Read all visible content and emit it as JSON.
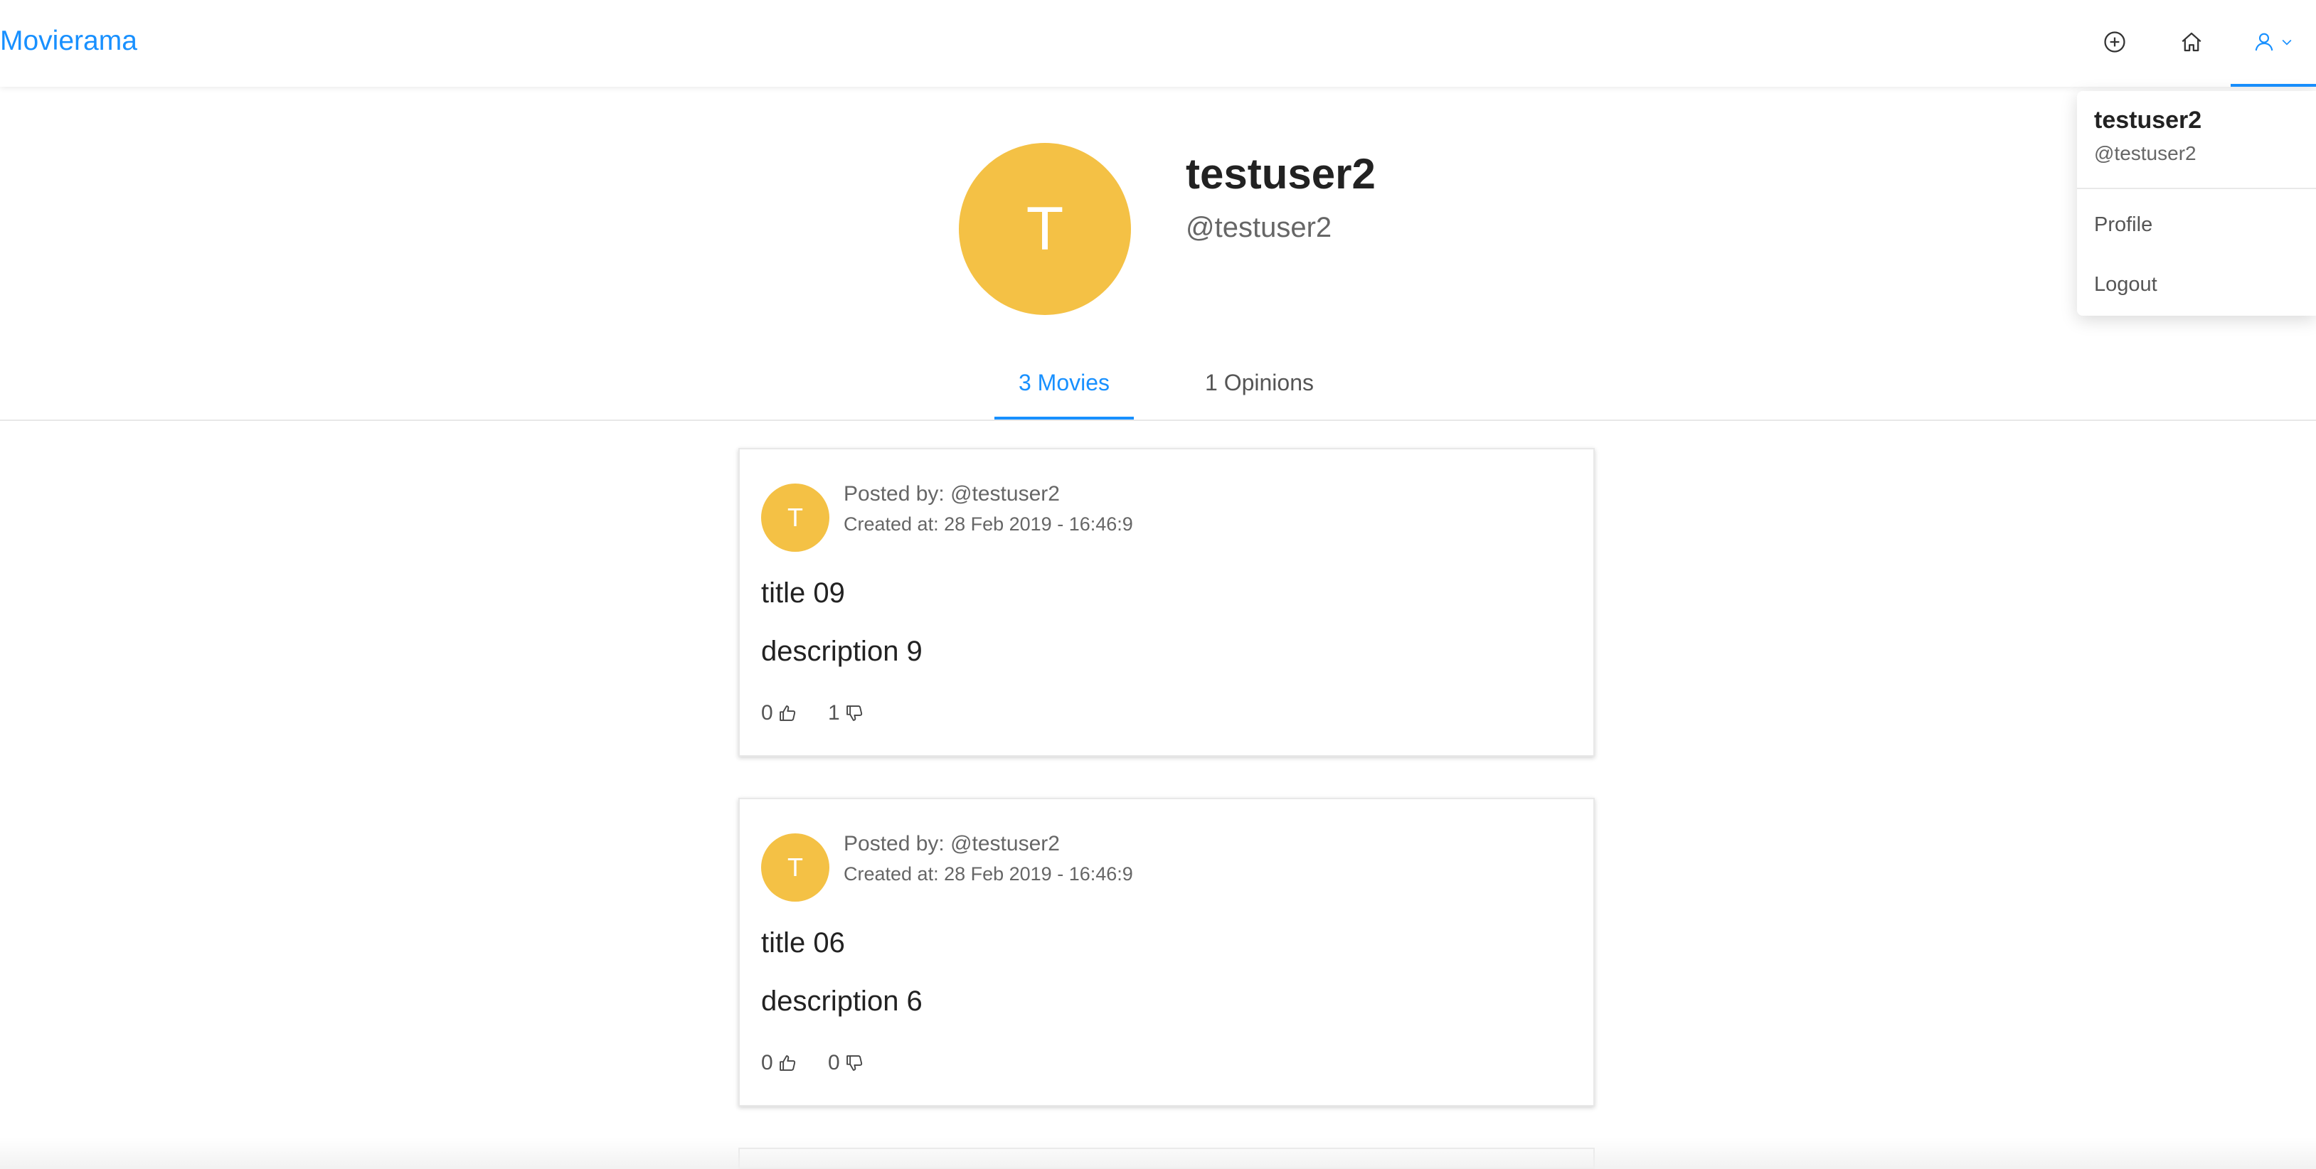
{
  "header": {
    "brand": "Movierama",
    "icons": {
      "add": "plus-circle-icon",
      "home": "home-icon",
      "user": "user-icon",
      "chevron": "chevron-down-icon"
    }
  },
  "user_menu": {
    "name": "testuser2",
    "handle": "@testuser2",
    "items": [
      {
        "label": "Profile"
      },
      {
        "label": "Logout"
      }
    ]
  },
  "profile": {
    "avatar_letter": "T",
    "name": "testuser2",
    "handle": "@testuser2"
  },
  "tabs": [
    {
      "label": "3 Movies",
      "active": true
    },
    {
      "label": "1 Opinions",
      "active": false
    }
  ],
  "movies": [
    {
      "avatar_letter": "T",
      "posted_by": "Posted by: @testuser2",
      "created_at": "Created at: 28 Feb 2019 - 16:46:9",
      "title": "title 09",
      "description": "description 9",
      "likes": "0",
      "hates": "1"
    },
    {
      "avatar_letter": "T",
      "posted_by": "Posted by: @testuser2",
      "created_at": "Created at: 28 Feb 2019 - 16:46:9",
      "title": "title 06",
      "description": "description 6",
      "likes": "0",
      "hates": "0"
    }
  ],
  "colors": {
    "accent": "#1890ff",
    "avatar": "#f4c145"
  }
}
